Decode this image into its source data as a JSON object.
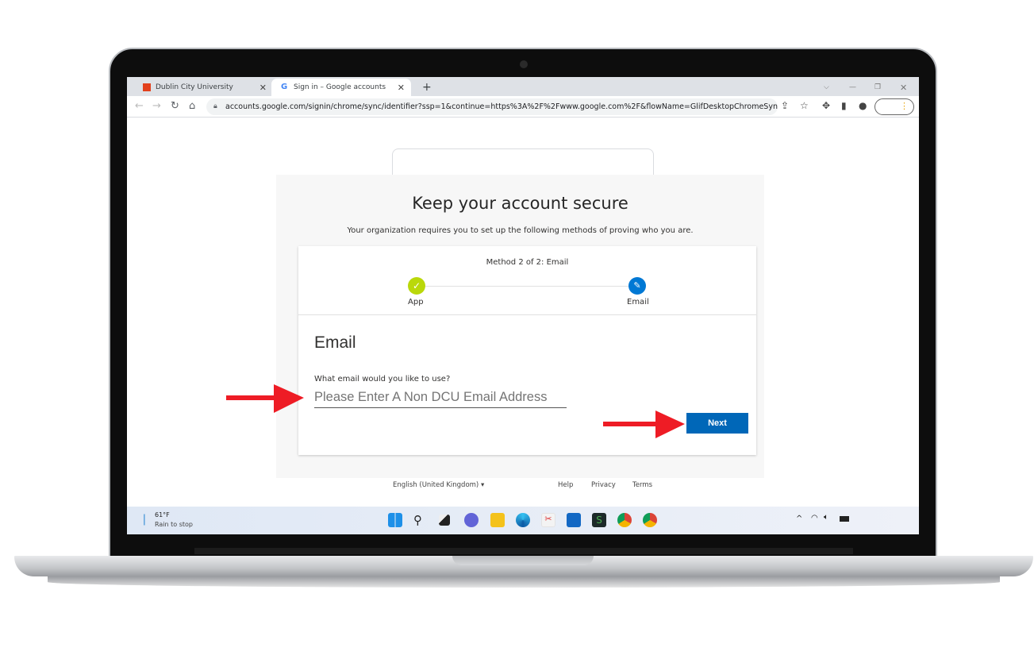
{
  "browser": {
    "tabs": [
      {
        "label": "Dublin City University",
        "active": false
      },
      {
        "label": "Sign in – Google accounts",
        "active": true
      }
    ],
    "url": "accounts.google.com/signin/chrome/sync/identifier?ssp=1&continue=https%3A%2F%2Fwww.google.com%2F&flowName=GlifDesktopChromeSync",
    "icons": [
      "back-icon",
      "forward-icon",
      "reload-icon",
      "home-icon",
      "lock-icon",
      "share-icon",
      "star-icon",
      "extensions-icon",
      "side-panel-icon",
      "profile-icon",
      "menu-icon"
    ]
  },
  "page": {
    "title": "Keep your account secure",
    "subtitle": "Your organization requires you to set up the following methods of proving who you are.",
    "method": "Method 2 of 2: Email",
    "steps": [
      {
        "label": "App",
        "state": "complete",
        "color": "#bad80a"
      },
      {
        "label": "Email",
        "state": "current",
        "color": "#0078d4"
      }
    ],
    "section_title": "Email",
    "question": "What email would you like to use?",
    "email_placeholder": "Please Enter A Non DCU Email Address",
    "next_label": "Next",
    "accent": "#0067b8",
    "annotation_arrow_color": "#ee1c25"
  },
  "footer": {
    "language": "English (United Kingdom)",
    "links": [
      "Help",
      "Privacy",
      "Terms"
    ]
  },
  "taskbar": {
    "weather_temp": "61°F",
    "weather_text": "Rain to stop",
    "apps": [
      "windows-start-icon",
      "search-icon",
      "task-view-icon",
      "teams-chat-icon",
      "file-explorer-icon",
      "edge-icon",
      "snipping-tool-icon",
      "store-icon",
      "app-icon",
      "chrome-icon",
      "chrome-profile-icon"
    ],
    "tray": [
      "chevron-up-icon",
      "wifi-icon",
      "volume-icon",
      "battery-icon"
    ]
  }
}
